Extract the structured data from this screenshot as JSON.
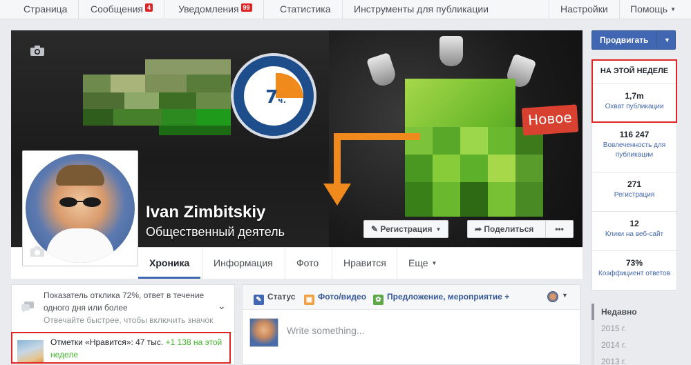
{
  "topnav": {
    "items": [
      {
        "label": "Страница"
      },
      {
        "label": "Сообщения",
        "badge": "4"
      },
      {
        "label": "Уведомления",
        "badge": "99"
      },
      {
        "label": "Статистика"
      },
      {
        "label": "Инструменты для публикации"
      }
    ],
    "settings": "Настройки",
    "help": "Помощь"
  },
  "cover": {
    "clock_value": "7",
    "clock_unit": "ч.",
    "sign_text": "Новое"
  },
  "profile": {
    "name": "Ivan Zimbitskiy",
    "subtitle": "Общественный деятель"
  },
  "buttons": {
    "register": "Регистрация",
    "share": "Поделиться",
    "more": "•••"
  },
  "tabs": [
    "Хроника",
    "Информация",
    "Фото",
    "Нравится",
    "Еще"
  ],
  "promote": {
    "label": "Продвигать"
  },
  "stats": {
    "header": "НА ЭТОЙ НЕДЕЛЕ",
    "items": [
      {
        "value": "1,7m",
        "label": "Охват публикации"
      },
      {
        "value": "116 247",
        "label": "Вовлеченность для публикации"
      },
      {
        "value": "271",
        "label": "Регистрация"
      },
      {
        "value": "12",
        "label": "Клики на веб-сайт"
      },
      {
        "value": "73%",
        "label": "Коэффициент ответов"
      }
    ]
  },
  "years": [
    "Недавно",
    "2015 г.",
    "2014 г.",
    "2013 г."
  ],
  "response": {
    "text": "Показатель отклика 72%, ответ в течение одного дня или более",
    "hint": "Отвечайте быстрее, чтобы включить значок"
  },
  "likes": {
    "text": "Отметки «Нравится»: 47 тыс.",
    "delta": "+1 138 на этой неделе"
  },
  "composer": {
    "status": "Статус",
    "photo": "Фото/видео",
    "offer": "Предложение, мероприятие +",
    "placeholder": "Write something..."
  },
  "colors": {
    "accent": "#4267b2",
    "highlight": "#e02424",
    "positive": "#42b72a"
  }
}
